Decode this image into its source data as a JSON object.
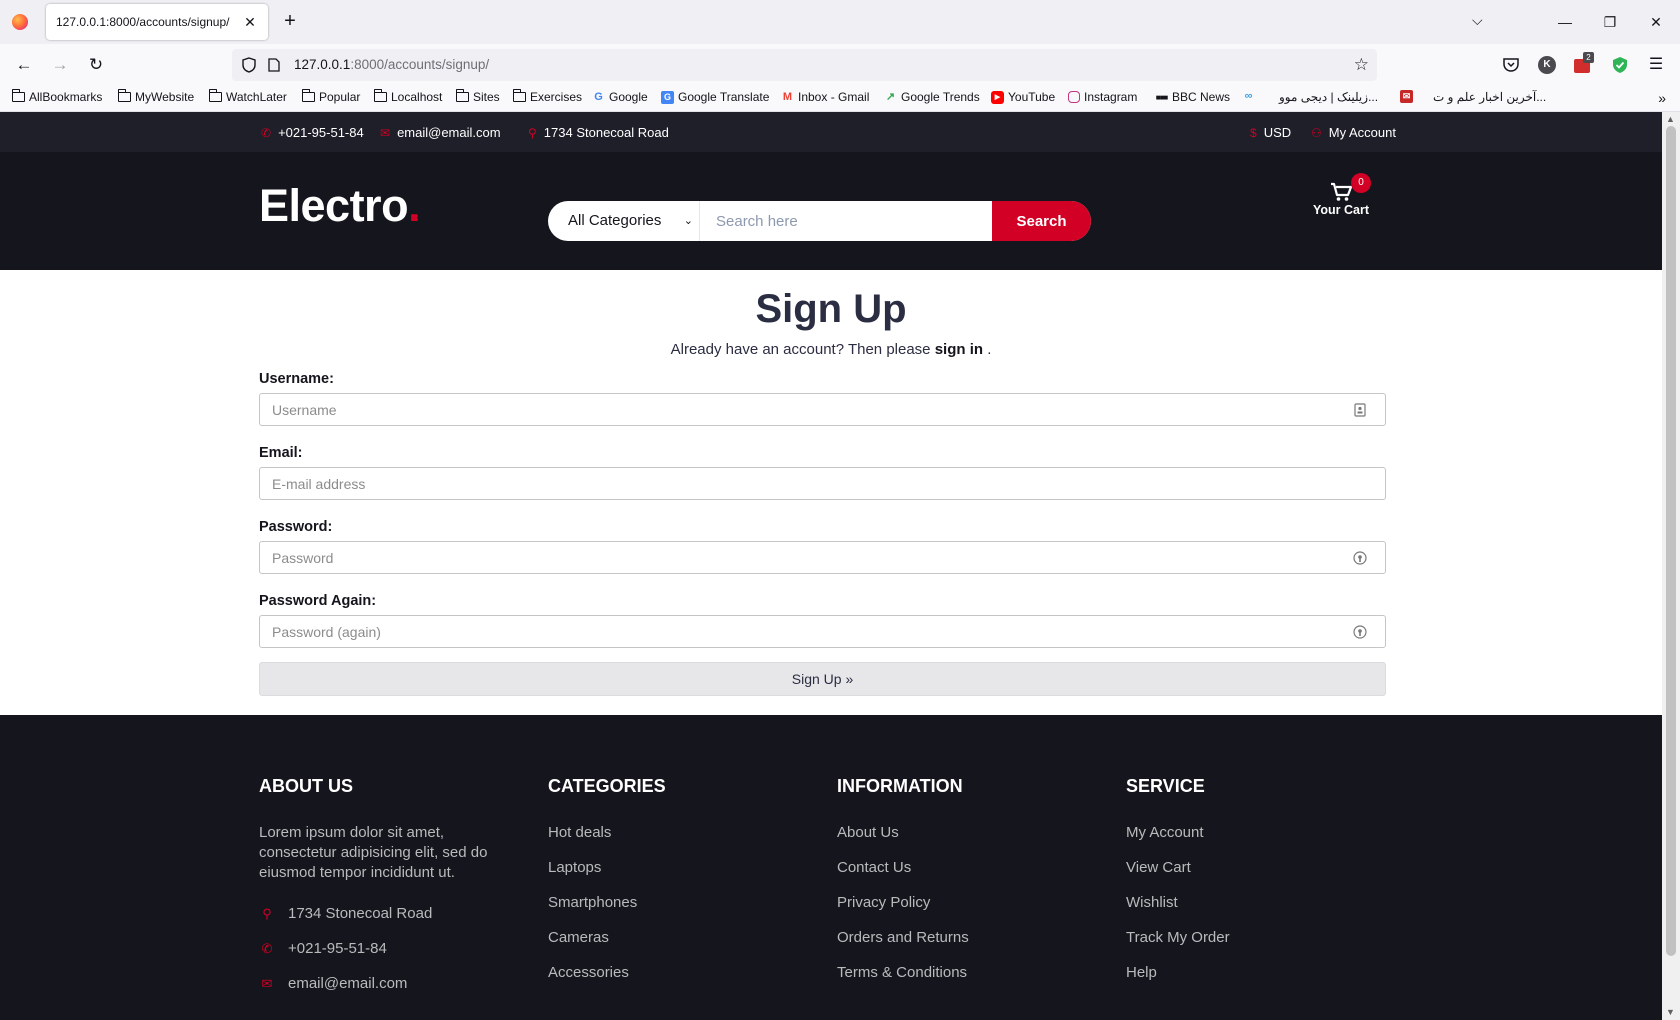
{
  "browser": {
    "tab_title": "127.0.0.1:8000/accounts/signup/",
    "url_host": "127.0.0.1",
    "url_rest": ":8000/accounts/signup/",
    "extension_badge": "2",
    "profile_initial": "K",
    "bookmarks": [
      {
        "label": "AllBookmarks",
        "icon": "folder-icon"
      },
      {
        "label": "MyWebsite",
        "icon": "folder-icon"
      },
      {
        "label": "WatchLater",
        "icon": "folder-icon"
      },
      {
        "label": "Popular",
        "icon": "folder-icon"
      },
      {
        "label": "Localhost",
        "icon": "folder-icon"
      },
      {
        "label": "Sites",
        "icon": "folder-icon"
      },
      {
        "label": "Exercises",
        "icon": "folder-icon"
      },
      {
        "label": "Google",
        "icon": "google-icon"
      },
      {
        "label": "Google Translate",
        "icon": "google-translate-icon"
      },
      {
        "label": "Inbox - Gmail",
        "icon": "gmail-icon"
      },
      {
        "label": "Google Trends",
        "icon": "google-trends-icon"
      },
      {
        "label": "YouTube",
        "icon": "youtube-icon"
      },
      {
        "label": "Instagram",
        "icon": "instagram-icon"
      },
      {
        "label": "BBC News",
        "icon": "bbc-icon"
      },
      {
        "label": "",
        "icon": "link-icon"
      },
      {
        "label": "زیلینک | دیجی موو...",
        "icon": "none"
      },
      {
        "label": "",
        "icon": "news-icon"
      },
      {
        "label": "آخرین اخبار علم و ت...",
        "icon": "none"
      }
    ]
  },
  "top_header": {
    "phone": "+021-95-51-84",
    "email": "email@email.com",
    "address": "1734 Stonecoal Road",
    "currency": "USD",
    "account": "My Account"
  },
  "header": {
    "logo_text": "Electro",
    "logo_dot": ".",
    "category_select": "All Categories",
    "search_placeholder": "Search here",
    "search_button": "Search",
    "cart_label": "Your Cart",
    "cart_count": "0"
  },
  "signup": {
    "title": "Sign Up",
    "subtitle_prefix": "Already have an account? Then please",
    "signin_link": "sign in",
    "subtitle_suffix": ".",
    "fields": [
      {
        "label": "Username:",
        "placeholder": "Username"
      },
      {
        "label": "Email:",
        "placeholder": "E-mail address"
      },
      {
        "label": "Password:",
        "placeholder": "Password"
      },
      {
        "label": "Password Again:",
        "placeholder": "Password (again)"
      }
    ],
    "submit": "Sign Up »"
  },
  "footer": {
    "about": {
      "title": "ABOUT US",
      "text": "Lorem ipsum dolor sit amet, consectetur adipisicing elit, sed do eiusmod tempor incididunt ut.",
      "address": "1734 Stonecoal Road",
      "phone": "+021-95-51-84",
      "email": "email@email.com"
    },
    "categories": {
      "title": "CATEGORIES",
      "links": [
        "Hot deals",
        "Laptops",
        "Smartphones",
        "Cameras",
        "Accessories"
      ]
    },
    "information": {
      "title": "INFORMATION",
      "links": [
        "About Us",
        "Contact Us",
        "Privacy Policy",
        "Orders and Returns",
        "Terms & Conditions"
      ]
    },
    "service": {
      "title": "SERVICE",
      "links": [
        "My Account",
        "View Cart",
        "Wishlist",
        "Track My Order",
        "Help"
      ]
    }
  },
  "colors": {
    "accent": "#d10024",
    "header_dark": "#15161d",
    "top_bar": "#1e1f29",
    "text_dark": "#2b2d42"
  }
}
